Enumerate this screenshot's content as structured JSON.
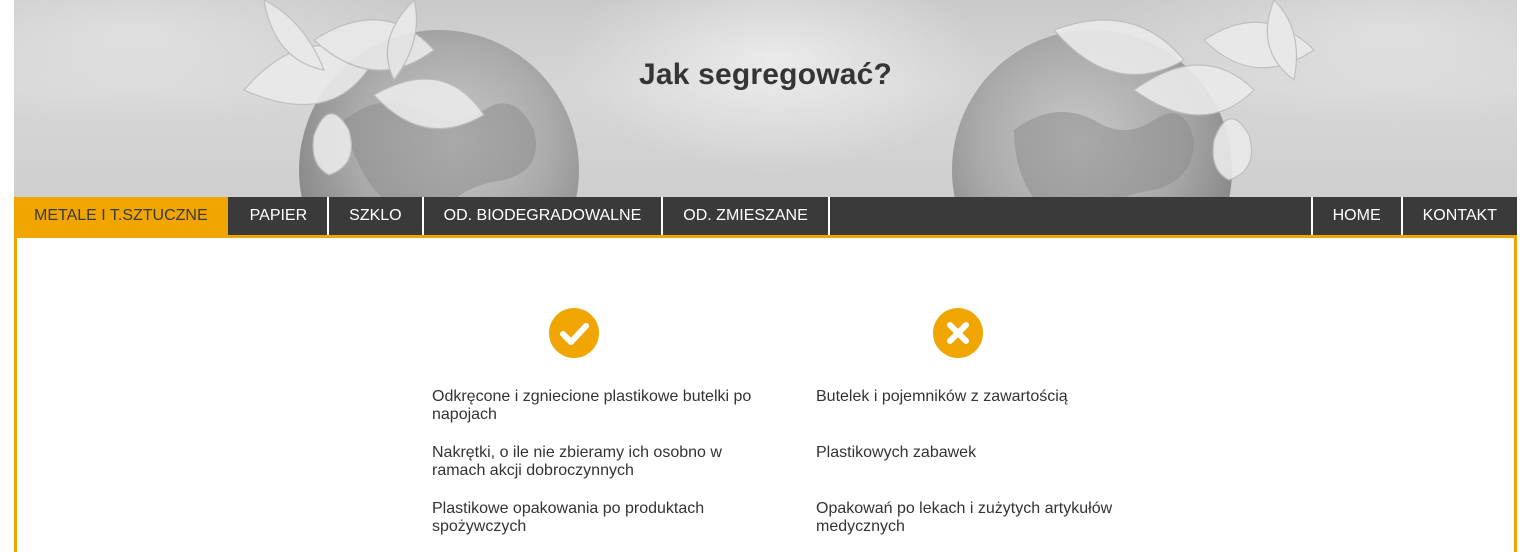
{
  "header": {
    "title": "Jak segregować?"
  },
  "nav": {
    "left": [
      {
        "label": "METALE I T.SZTUCZNE",
        "active": true
      },
      {
        "label": "PAPIER",
        "active": false
      },
      {
        "label": "SZKLO",
        "active": false
      },
      {
        "label": "OD. BIODEGRADOWALNE",
        "active": false
      },
      {
        "label": "OD. ZMIESZANE",
        "active": false
      }
    ],
    "right": [
      {
        "label": "HOME"
      },
      {
        "label": "KONTAKT"
      }
    ]
  },
  "content": {
    "allowed": {
      "icon": "check-circle-icon",
      "items": [
        "Odkręcone i zgniecione plastikowe butelki po napojach",
        "Nakrętki, o ile nie zbieramy ich osobno w ramach akcji dobroczynnych",
        "Plastikowe opakowania po produktach spożywczych"
      ]
    },
    "forbidden": {
      "icon": "x-circle-icon",
      "items": [
        "Butelek i pojemników z zawartością",
        "Plastikowych zabawek",
        "Opakowań po lekach i zużytych artykułów medycznych"
      ]
    }
  },
  "colors": {
    "accent": "#f0a500",
    "nav_bg": "#3a3a3a",
    "text": "#333333"
  }
}
